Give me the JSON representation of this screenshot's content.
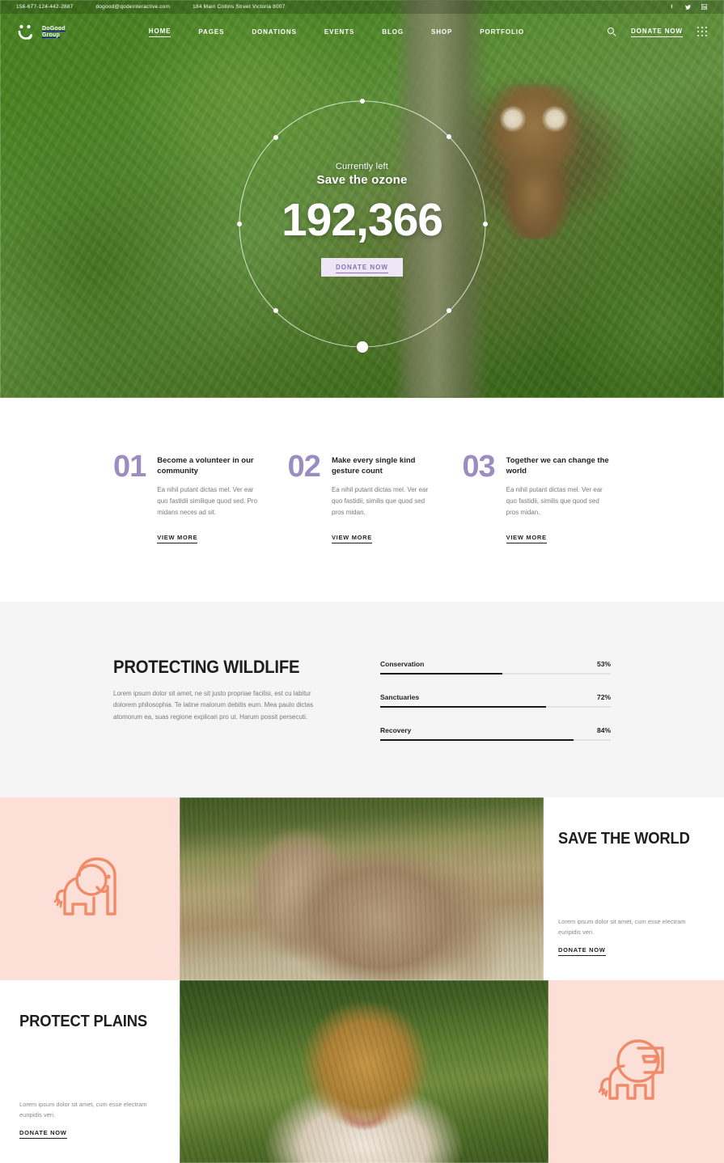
{
  "topbar": {
    "phone": "156-677-124-442-2887",
    "email": "dogood@qodeinteractive.com",
    "address": "184 Main Collins Street Victoria 8007",
    "social": [
      {
        "name": "facebook-icon",
        "glyph": "f"
      },
      {
        "name": "twitter-icon",
        "glyph": "ᵛ"
      },
      {
        "name": "linkedin-icon",
        "glyph": "in"
      }
    ]
  },
  "header": {
    "logo_line1": "DoGood",
    "logo_line2": "Group",
    "logo_icon": "smiley-face-icon",
    "nav": [
      {
        "label": "HOME",
        "active": true
      },
      {
        "label": "PAGES",
        "active": false
      },
      {
        "label": "DONATIONS",
        "active": false
      },
      {
        "label": "EVENTS",
        "active": false
      },
      {
        "label": "BLOG",
        "active": false
      },
      {
        "label": "SHOP",
        "active": false
      },
      {
        "label": "PORTFOLIO",
        "active": false
      }
    ],
    "search_icon": "search-icon",
    "donate_label": "DONATE NOW",
    "grid_icon": "grid-menu-icon"
  },
  "hero": {
    "subtitle": "Currently left",
    "title": "Save the ozone",
    "counter": "192,366",
    "button_label": "DONATE NOW",
    "ring_dots": 9
  },
  "steps": [
    {
      "number": "01",
      "title": "Become a volunteer in our community",
      "text": "Ea nihil putant dictas mel. Ver ear quo fastidii similique quod sed. Pro midans neces ad sit.",
      "link": "VIEW MORE"
    },
    {
      "number": "02",
      "title": "Make every single kind gesture count",
      "text": "Ea nihil putant dictas mel. Ver ear quo fastidii, similis que quod sed pros midan.",
      "link": "VIEW MORE"
    },
    {
      "number": "03",
      "title": "Together we can change the world",
      "text": "Ea nihil putant dictas mel. Ver ear quo fastidii, similis que quod sed pros midan.",
      "link": "VIEW MORE"
    }
  ],
  "wildlife": {
    "title": "PROTECTING WILDLIFE",
    "text": "Lorem ipsum dolor sit amet, ne sit justo propriae facilisi, est cu labitur dolorem philosophia. Te latine malorum debitis eum. Mea paulo dictas atomorum ea, suas regione explicari pro ut. Harum possit persecuti.",
    "bars": [
      {
        "label": "Conservation",
        "pct": "53%",
        "value": 53
      },
      {
        "label": "Sanctuaries",
        "pct": "72%",
        "value": 72
      },
      {
        "label": "Recovery",
        "pct": "84%",
        "value": 84
      }
    ]
  },
  "promos": {
    "row1": {
      "icon": "elephant-icon",
      "image": "elephant-photo",
      "heading": "SAVE THE WORLD",
      "text": "Lorem ipsum dolor sit amet, cum esse electram euripidis veri.",
      "link": "DONATE NOW"
    },
    "row2": {
      "heading": "PROTECT PLAINS",
      "text": "Lorem ipsum dolor sit amet, cum esse electram euripidis veri.",
      "link": "DONATE NOW",
      "image": "lion-photo",
      "icon": "lion-icon"
    }
  },
  "colors": {
    "accent_purple": "#9b8dc0",
    "pink_bg": "#fce0d8",
    "coral_icon": "#f08b6a",
    "gray_bg": "#f5f5f5",
    "dark": "#1e1e1e"
  }
}
